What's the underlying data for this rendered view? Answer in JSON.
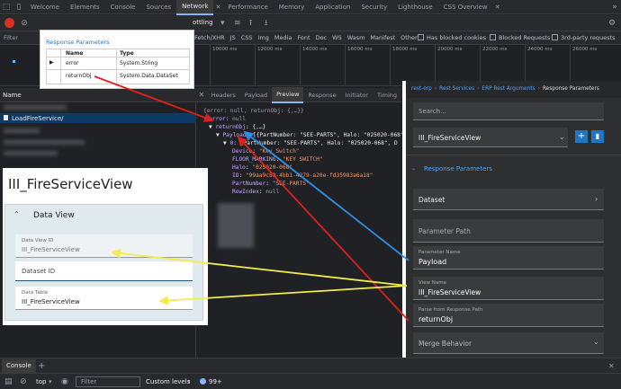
{
  "devtools": {
    "tabs": [
      "Welcome",
      "Elements",
      "Console",
      "Sources",
      "Network",
      "Performance",
      "Memory",
      "Application",
      "Security",
      "Lighthouse",
      "CSS Overview"
    ],
    "active_tab": "Network",
    "toolbar": {
      "throttling": "ottling"
    },
    "filter": {
      "placeholder": "Filter",
      "types": [
        "Fetch/XHR",
        "JS",
        "CSS",
        "Img",
        "Media",
        "Font",
        "Doc",
        "WS",
        "Wasm",
        "Manifest",
        "Other"
      ],
      "has_blocked_cookies": "Has blocked cookies",
      "blocked_requests": "Blocked Requests",
      "third_party": "3rd-party requests"
    },
    "timeline_ticks": [
      "10000 ms",
      "12000 ms",
      "14000 ms",
      "16000 ms",
      "18000 ms",
      "20000 ms",
      "22000 ms",
      "24000 ms",
      "26000 ms"
    ],
    "name_header": "Name",
    "selected_request": "LoadFireService/",
    "preview_tabs": [
      "Headers",
      "Payload",
      "Preview",
      "Response",
      "Initiator",
      "Timing"
    ],
    "preview_active": "Preview"
  },
  "preview": {
    "l1": "{error: null, returnObj: {,…}}",
    "l2_key": "error",
    "l2_val": "null",
    "l3_key": "returnObj",
    "l3_val": "{,…}",
    "l4_key": "Payload",
    "l4_val": "[{PartNumber: \"SEE-PARTS\", Halo: \"025020-068\"",
    "l5_key": "0",
    "l5_val": "{PartNumber: \"SEE-PARTS\", Halo: \"025020-068\", D",
    "device_key": "Device",
    "device_val": "\"Key Switch\"",
    "floor_key": "FLOOR_MARKING",
    "floor_val": "\"KEY SWITCH\"",
    "halo_key": "Halo",
    "halo_val": "\"025020-068\"",
    "id_key": "ID",
    "id_val": "\"99aa9c58-4bb1-4279-a20e-fd35983a6a18\"",
    "part_key": "PartNumber",
    "part_val": "\"SEE-PARTS\"",
    "row_key": "RowIndex",
    "row_val": "null"
  },
  "popup": {
    "title": "Response Parameters",
    "col_name": "Name",
    "col_type": "Type",
    "rows": [
      {
        "name": "error",
        "type": "System.String"
      },
      {
        "name": "returnObj",
        "type": "System.Data.DataSet"
      }
    ]
  },
  "dataview": {
    "title": "III_FireServiceView",
    "section": "Data View",
    "view_id_label": "Data View ID",
    "view_id_value": "III_FireServiceView",
    "dataset_label": "Dataset ID",
    "table_label": "Data Table",
    "table_value": "III_FireServiceView"
  },
  "erp": {
    "breadcrumb": [
      "rest-erp",
      "Rest Services",
      "ERP Rest Arguments",
      "Response Parameters"
    ],
    "search_placeholder": "Search...",
    "selected": "III_FireServiceView",
    "section": "Response Parameters",
    "dataset": "Dataset",
    "param_path_placeholder": "Parameter Path",
    "param_name_label": "Parameter Name",
    "param_name_value": "Payload",
    "view_name_label": "View Name",
    "view_name_value": "III_FireServiceView",
    "parse_label": "Parse from Response Path",
    "parse_value": "returnObj",
    "merge": "Merge Behavior"
  },
  "console": {
    "tab": "Console",
    "context": "top",
    "filter_placeholder": "Filter",
    "levels": "Custom levels",
    "badge": "99+"
  },
  "colors": {
    "accent": "#8ab4f8",
    "erp_blue": "#1d78c1",
    "arrow_red": "#e0201e",
    "arrow_blue": "#2f8de4",
    "arrow_yellow": "#f2ec4f"
  }
}
